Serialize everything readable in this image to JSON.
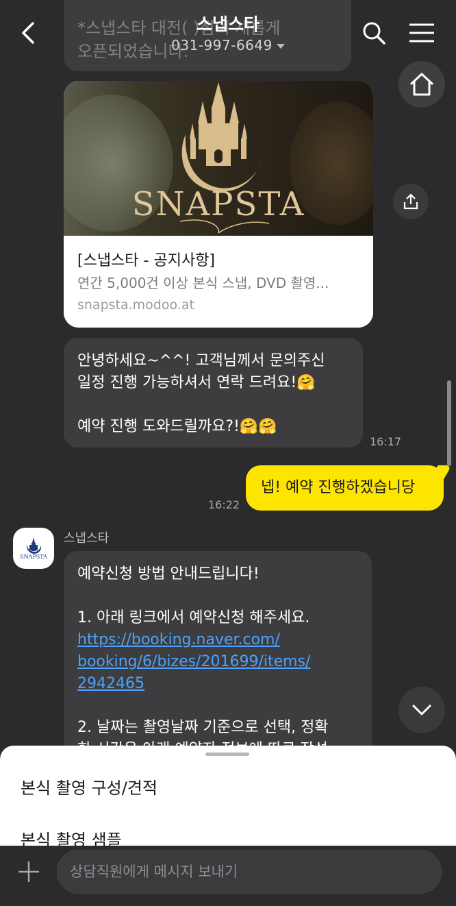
{
  "header": {
    "title": "스냅스타",
    "phone": "031-997-6649",
    "back_icon": "back-arrow-icon",
    "search_icon": "search-icon",
    "menu_icon": "hamburger-menu-icon"
  },
  "previous_message": {
    "text": "*스냅스타 대전(  )점이 새롭게\n오픈되었습니다."
  },
  "link_card": {
    "logo_text": "SNAPSTA",
    "title": "[스냅스타 - 공지사항]",
    "description": "연간 5,000건 이상 본식 스냅, DVD 촬영...",
    "url": "snapsta.modoo.at"
  },
  "messages": [
    {
      "lines": [
        "안녕하세요~^^! 고객님께서 문의주신",
        "일정 진행 가능하셔서 연락 드려요!🤗",
        "",
        "예약 진행 도와드릴까요?!🤗🤗"
      ],
      "time": "16:17"
    },
    {
      "text": "넵! 예약 진행하겠습니당",
      "time": "16:22"
    }
  ],
  "sender": {
    "name": "스냅스타",
    "avatar_text": "SNAPSTA"
  },
  "guide_message": {
    "line1": "예약신청 방법 안내드립니다!",
    "line2": "1. 아래 링크에서 예약신청 해주세요.",
    "link_lines": [
      "https://booking.naver.com/",
      "booking/6/bizes/201699/items/",
      "2942465"
    ],
    "line3": "2. 날짜는 촬영날짜 기준으로 선택, 정확",
    "line4": "한 시간은 아래 예약자 정보에 따로 작성"
  },
  "bottom_sheet": {
    "items": [
      "본식 촬영 구성/견적",
      "본식 촬영 샘플"
    ]
  },
  "composer": {
    "placeholder": "상담직원에게 메시지 보내기"
  },
  "colors": {
    "background": "#2b2b2d",
    "incoming_bubble": "#3d3d40",
    "outgoing_bubble": "#fee500",
    "link": "#4aa3ff",
    "logo_gold": "#e0c79a"
  }
}
